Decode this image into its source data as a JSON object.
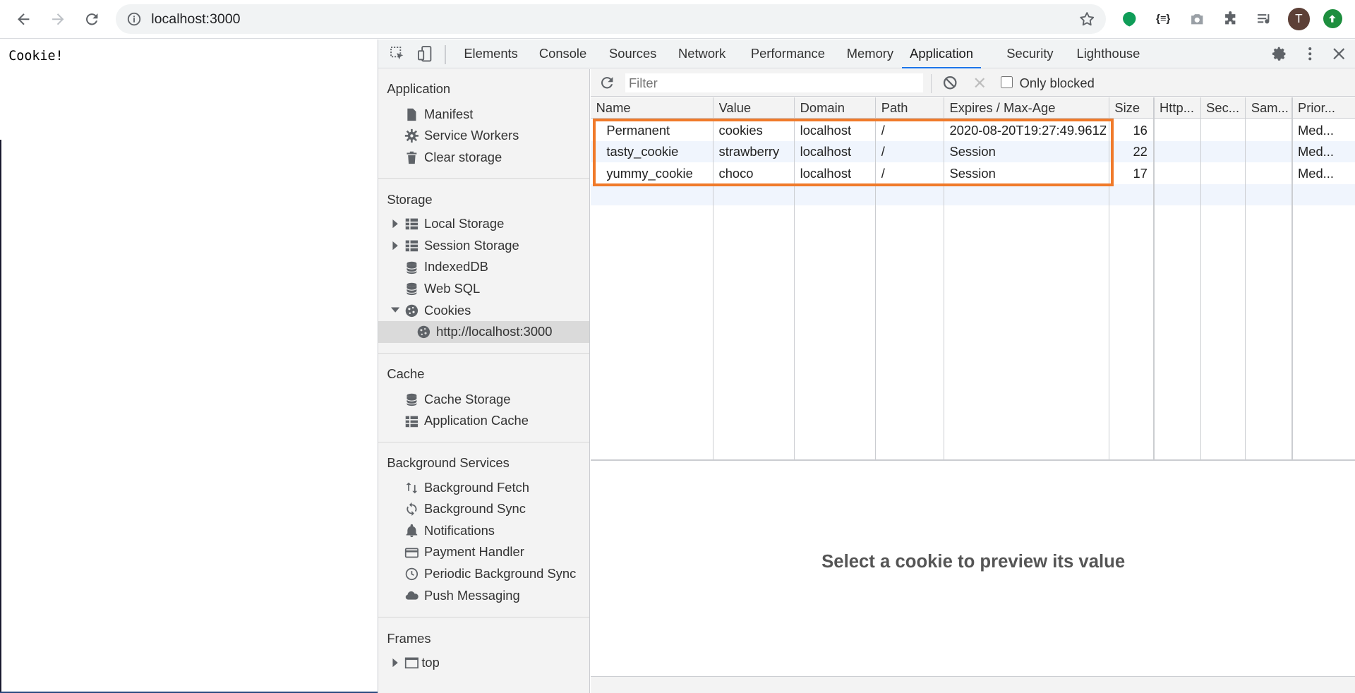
{
  "browser": {
    "url": "localhost:3000",
    "avatar_letter": "T",
    "ext_devtools_label": "{≡}"
  },
  "page": {
    "text": "Cookie!"
  },
  "devtools": {
    "tabs": [
      "Elements",
      "Console",
      "Sources",
      "Network",
      "Performance",
      "Memory",
      "Application",
      "Security",
      "Lighthouse"
    ],
    "active_tab": "Application"
  },
  "sidebar": {
    "application_head": "Application",
    "application_items": [
      "Manifest",
      "Service Workers",
      "Clear storage"
    ],
    "storage_head": "Storage",
    "storage_items": [
      "Local Storage",
      "Session Storage",
      "IndexedDB",
      "Web SQL",
      "Cookies"
    ],
    "cookies_child": "http://localhost:3000",
    "cache_head": "Cache",
    "cache_items": [
      "Cache Storage",
      "Application Cache"
    ],
    "bg_head": "Background Services",
    "bg_items": [
      "Background Fetch",
      "Background Sync",
      "Notifications",
      "Payment Handler",
      "Periodic Background Sync",
      "Push Messaging"
    ],
    "frames_head": "Frames",
    "frames_items": [
      "top"
    ]
  },
  "toolbar": {
    "filter_placeholder": "Filter",
    "only_blocked": "Only blocked"
  },
  "table": {
    "columns": [
      "Name",
      "Value",
      "Domain",
      "Path",
      "Expires / Max-Age",
      "Size",
      "Http...",
      "Sec...",
      "Sam...",
      "Prior..."
    ],
    "rows": [
      [
        "Permanent",
        "cookies",
        "localhost",
        "/",
        "2020-08-20T19:27:49.961Z",
        "16",
        "",
        "",
        "",
        "Med..."
      ],
      [
        "tasty_cookie",
        "strawberry",
        "localhost",
        "/",
        "Session",
        "22",
        "",
        "",
        "",
        "Med..."
      ],
      [
        "yummy_cookie",
        "choco",
        "localhost",
        "/",
        "Session",
        "17",
        "",
        "",
        "",
        "Med..."
      ]
    ]
  },
  "preview": {
    "message": "Select a cookie to preview its value"
  },
  "colors": {
    "highlight": "#f07a2a",
    "active_tab_underline": "#1a73e8",
    "update_badge": "#1e8e3e"
  }
}
